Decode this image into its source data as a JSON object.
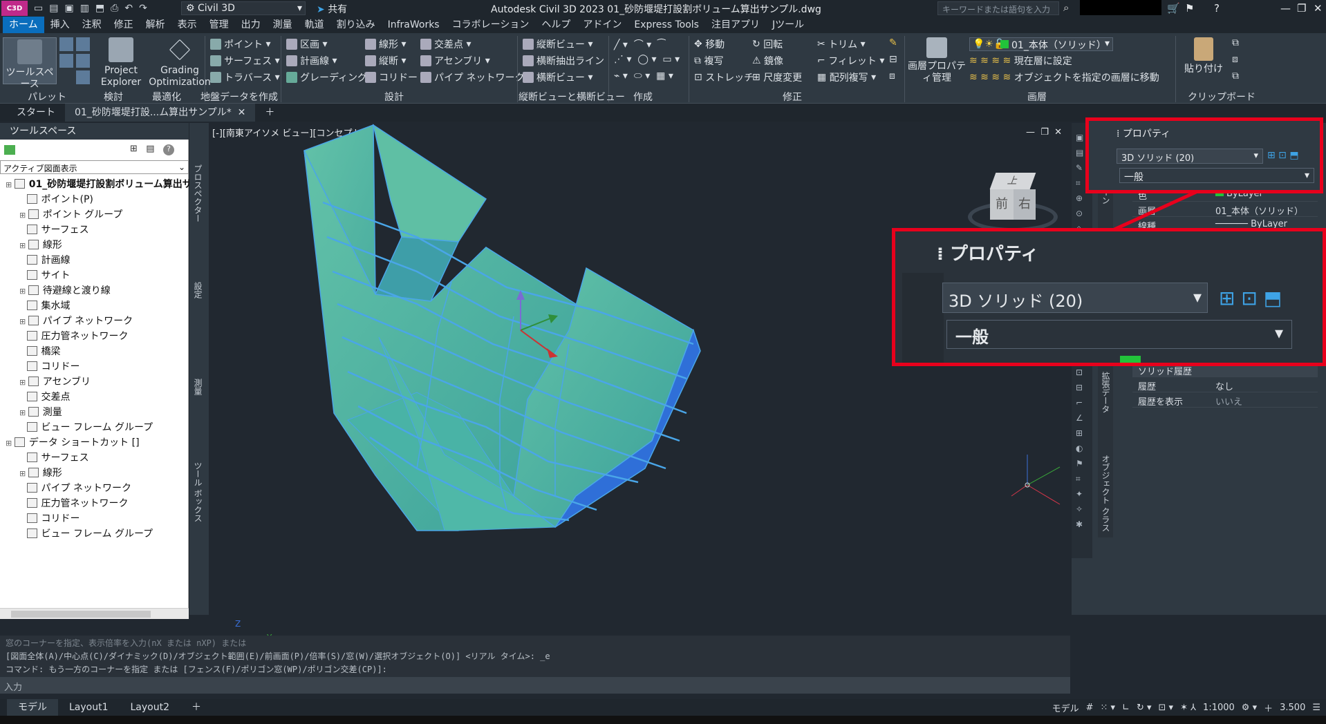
{
  "app": {
    "logo": "C3D",
    "workspace": "Civil 3D",
    "share": "共有",
    "title": "Autodesk Civil 3D 2023    01_砂防堰堤打設割ボリューム算出サンプル.dwg",
    "search_placeholder": "キーワードまたは語句を入力"
  },
  "menu": [
    "ホーム",
    "挿入",
    "注釈",
    "修正",
    "解析",
    "表示",
    "管理",
    "出力",
    "測量",
    "軌道",
    "割り込み",
    "InfraWorks",
    "コラボレーション",
    "ヘルプ",
    "アドイン",
    "Express Tools",
    "注目アプリ",
    "Jツール"
  ],
  "ribbon": {
    "big": [
      {
        "label": "ツールスペース"
      },
      {
        "label": "Project Explorer"
      },
      {
        "label": "Grading Optimization"
      }
    ],
    "col1": [
      "ポイント",
      "サーフェス",
      "トラバース"
    ],
    "col2": [
      "区画",
      "計画線",
      "グレーディング"
    ],
    "col3": [
      "線形",
      "縦断",
      "コリドー"
    ],
    "col4": [
      "交差点",
      "アセンブリ",
      "パイプ ネットワーク"
    ],
    "col5": [
      "縦断ビュー",
      "横断抽出ライン",
      "横断ビュー"
    ],
    "modify1": [
      "移動",
      "複写",
      "ストレッチ"
    ],
    "modify2": [
      "回転",
      "鏡像",
      "尺度変更"
    ],
    "modify3": [
      "トリム",
      "フィレット",
      "配列複写"
    ],
    "layer_big": "画層プロパティ管理",
    "layer_current": "01_本体（ソリッド）",
    "layer_a": "現在層に設定",
    "layer_b": "オブジェクトを指定の画層に移動",
    "paste": "貼り付け",
    "panels": [
      "パレット",
      "検討",
      "最適化",
      "地盤データを作成",
      "設計",
      "縦断ビューと横断ビュー",
      "作成",
      "修正",
      "画層",
      "クリップボード"
    ]
  },
  "tabs": {
    "start": "スタート",
    "doc": "01_砂防堰堤打設...ム算出サンプル*"
  },
  "toolspace": {
    "header": "ツールスペース",
    "view": "アクティブ図面表示",
    "tree": [
      "01_砂防堰堤打設割ボリューム算出サ...",
      "ポイント(P)",
      "ポイント グループ",
      "サーフェス",
      "線形",
      "計画線",
      "サイト",
      "待避線と渡り線",
      "集水域",
      "パイプ ネットワーク",
      "圧力管ネットワーク",
      "橋梁",
      "コリドー",
      "アセンブリ",
      "交差点",
      "測量",
      "ビュー フレーム グループ",
      "データ ショートカット []",
      "サーフェス",
      "線形",
      "パイプ ネットワーク",
      "圧力管ネットワーク",
      "コリドー",
      "ビュー フレーム グループ"
    ],
    "side_tabs": [
      "プロスペクター",
      "設定",
      "測量",
      "ツール ボックス"
    ]
  },
  "viewport": {
    "label": "[-][南東アイソメ ビュー][コンセプト]",
    "cube_top": "上",
    "cube_front": "前",
    "cube_right": "右"
  },
  "command": {
    "lines": [
      "窓のコーナーを指定、表示倍率を入力(nX または nXP) または",
      "[図面全体(A)/中心点(C)/ダイナミック(D)/オブジェクト範囲(E)/前画面(P)/倍率(S)/窓(W)/選択オブジェクト(O)] <リアル タイム>: _e",
      "コマンド: もう一方のコーナーを指定 または [フェンス(F)/ポリゴン窓(WP)/ポリゴン交差(CP)]:"
    ],
    "input": "入力"
  },
  "layouts": [
    "モデル",
    "Layout1",
    "Layout2"
  ],
  "status": {
    "model": "モデル",
    "scale": "1:1000",
    "value": "3.500"
  },
  "properties": {
    "title": "プロパティ",
    "object": "3D ソリッド (20)",
    "group": "一般",
    "rows": [
      {
        "k": "色",
        "v": "ByLayer"
      },
      {
        "k": "画層",
        "v": "01_本体（ソリッド）"
      },
      {
        "k": "線種",
        "v": "ByLayer"
      }
    ],
    "history_section": "ソリッド履歴",
    "history": [
      {
        "k": "履歴",
        "v": "なし"
      },
      {
        "k": "履歴を表示",
        "v": "いいえ"
      }
    ],
    "side_tabs": [
      "デザイン",
      "拡張データ",
      "オブジェクト クラス"
    ]
  }
}
